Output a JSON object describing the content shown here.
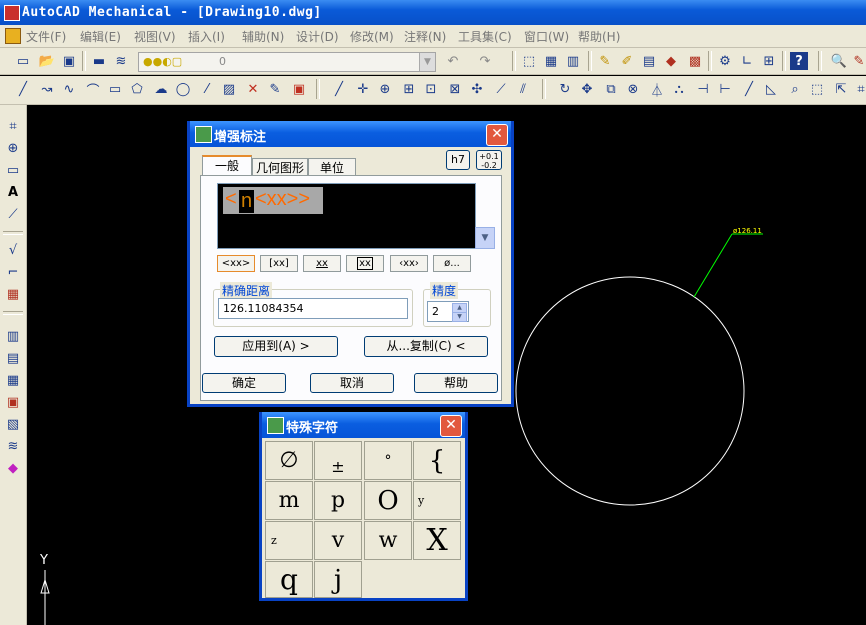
{
  "window": {
    "title": "AutoCAD Mechanical - [Drawing10.dwg]"
  },
  "menu": [
    "文件(F)",
    "编辑(E)",
    "视图(V)",
    "插入(I)",
    "辅助(N)",
    "设计(D)",
    "修改(M)",
    "注释(N)",
    "工具集(C)",
    "窗口(W)",
    "帮助(H)"
  ],
  "layer_combo": {
    "value": "0"
  },
  "drawing": {
    "dimension_text": "ø126.11",
    "ucs_y_label": "Y"
  },
  "dialog": {
    "title": "增强标注",
    "tabs": [
      "一般",
      "几何图形",
      "单位"
    ],
    "text_prefix": "<",
    "text_n": "n",
    "text_rest": "<xx>>",
    "tol_h7": "h7",
    "tol_stack_top": "+0.1",
    "tol_stack_bottom": "-0.2",
    "format_buttons": [
      "<xx>",
      "[xx]",
      "xx",
      "xx",
      "‹xx›",
      "ø..."
    ],
    "exact_distance_label": "精确距离",
    "exact_distance_value": "126.11084354",
    "precision_label": "精度",
    "precision_value": "2",
    "apply_to_button": "应用到(A) >",
    "copy_from_button": "从...复制(C) <",
    "ok_button": "确定",
    "cancel_button": "取消",
    "help_button": "帮助"
  },
  "special_chars": {
    "title": "特殊字符",
    "chars": [
      "∅",
      "±",
      "°",
      "{",
      "m",
      "p",
      "O",
      "y",
      "z",
      "v",
      "w",
      "X",
      "q",
      "j",
      ""
    ]
  },
  "colors": {
    "circle": "#ffffff",
    "dimension": "#00ff00",
    "dim_text": "#ffff00",
    "dialog_text_orange": "#ff6a00"
  }
}
